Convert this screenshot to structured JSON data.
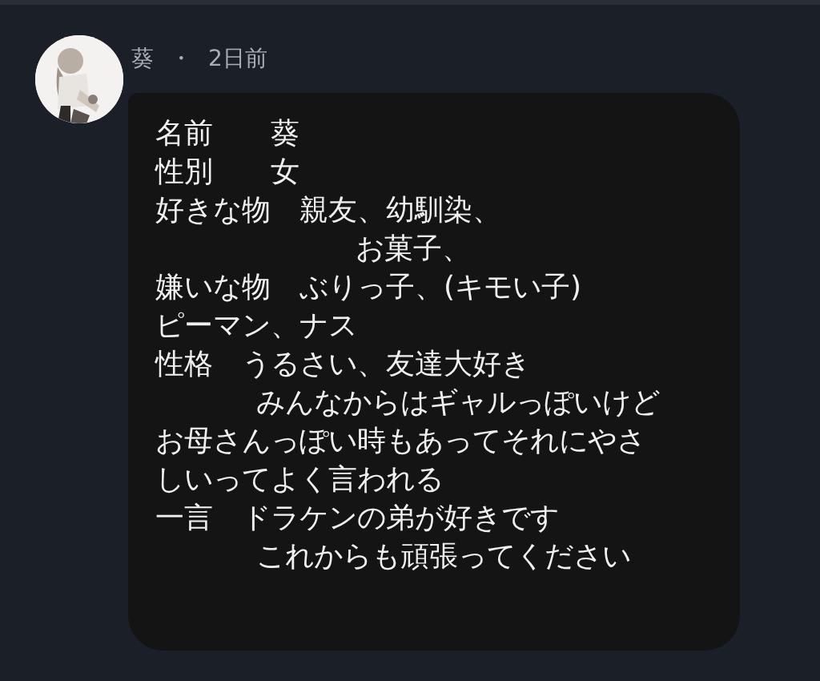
{
  "post": {
    "author": "葵",
    "separator": "・",
    "time": "2日前"
  },
  "message": {
    "lines": [
      {
        "kind": "line",
        "text": "名前　　葵"
      },
      {
        "kind": "line",
        "text": "性別　　女"
      },
      {
        "kind": "line",
        "text": "好きな物　親友、幼馴染、"
      },
      {
        "kind": "deep_indent",
        "text": "お菓子、"
      },
      {
        "kind": "line",
        "text": "嫌いな物　ぶりっ子、(キモい子)"
      },
      {
        "kind": "line",
        "text": "ピーマン、ナス"
      },
      {
        "kind": "line",
        "text": "性格　うるさい、友達大好き"
      },
      {
        "kind": "indent",
        "text": "みんなからはギャルっぽいけど"
      },
      {
        "kind": "line",
        "text": "お母さんっぽい時もあってそれにやさ"
      },
      {
        "kind": "line",
        "text": "しいってよく言われる"
      },
      {
        "kind": "line",
        "text": "一言　ドラケンの弟が好きです"
      },
      {
        "kind": "indent",
        "text": "これからも頑張ってください"
      }
    ]
  }
}
